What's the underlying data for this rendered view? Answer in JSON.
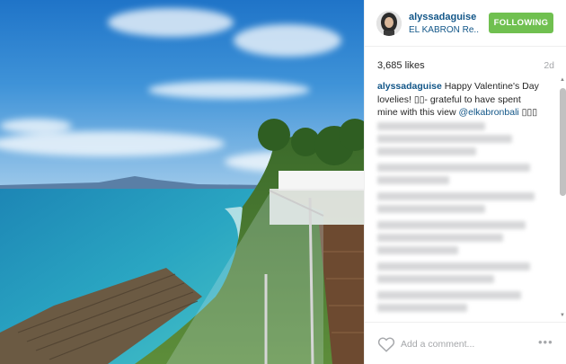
{
  "post": {
    "username": "alyssadaguise",
    "location": "EL KABRON Re...",
    "follow_label": "FOLLOWING",
    "likes": "3,685 likes",
    "age": "2d"
  },
  "caption": {
    "username": "alyssadaguise",
    "text_before": " Happy Valentine's Day lovelies! ▯▯- grateful to have spent mine with this view ",
    "mention": "@elkabronbali",
    "text_after": " ▯▯▯"
  },
  "footer": {
    "placeholder": "Add a comment...",
    "more_label": "•••"
  },
  "colors": {
    "link": "#125688",
    "follow_green": "#70c050",
    "muted": "#a5a7aa"
  },
  "icons": [
    "heart-icon",
    "more-options-icon"
  ]
}
